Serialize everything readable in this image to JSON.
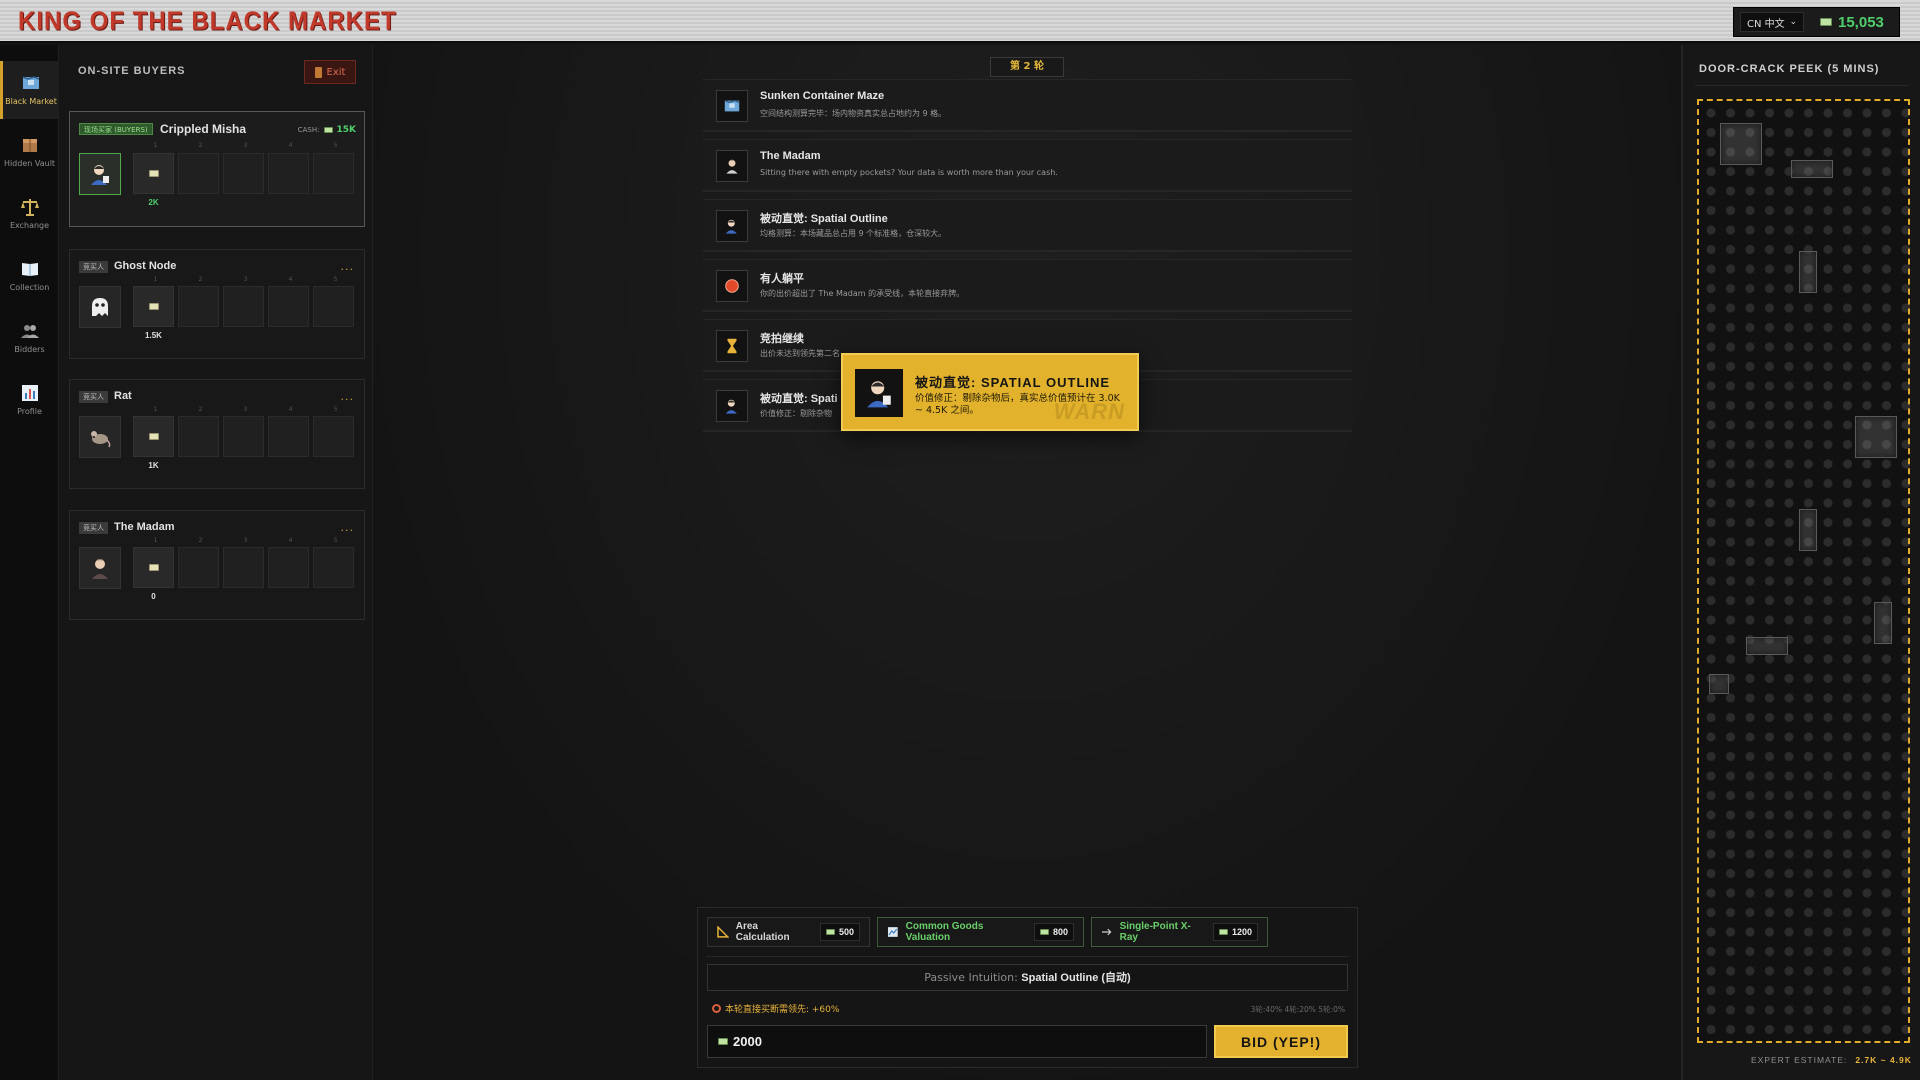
{
  "app": {
    "title": "KING OF THE BLACK MARKET",
    "language": "CN 中文",
    "cash": "15,053"
  },
  "nav": [
    {
      "label": "Black Market",
      "icon": "map-icon",
      "active": true
    },
    {
      "label": "Hidden Vault",
      "icon": "crate-icon"
    },
    {
      "label": "Exchange",
      "icon": "scale-icon"
    },
    {
      "label": "Collection",
      "icon": "book-icon"
    },
    {
      "label": "Bidders",
      "icon": "users-icon"
    },
    {
      "label": "Profile",
      "icon": "bar-chart-icon"
    }
  ],
  "buyers": {
    "title": "ON-SITE BUYERS",
    "exit_label": "Exit",
    "cards": [
      {
        "tag": "现场买家 (BUYERS)",
        "name": "Crippled Misha",
        "cash_label": "CASH:",
        "cash": "15K",
        "slots": [
          "1",
          "2",
          "3",
          "4",
          "5"
        ],
        "bid": "2K",
        "is_me": true,
        "avatar": "crippled-misha-avatar"
      },
      {
        "tag": "竞买人",
        "name": "Ghost Node",
        "more": "...",
        "slots": [
          "1",
          "2",
          "3",
          "4",
          "5"
        ],
        "bid": "1.5K",
        "avatar": "ghost-avatar"
      },
      {
        "tag": "竞买人",
        "name": "Rat",
        "more": "...",
        "slots": [
          "1",
          "2",
          "3",
          "4",
          "5"
        ],
        "bid": "1K",
        "avatar": "rat-avatar"
      },
      {
        "tag": "竞买人",
        "name": "The Madam",
        "more": "...",
        "slots": [
          "1",
          "2",
          "3",
          "4",
          "5"
        ],
        "bid": "0",
        "avatar": "madam-avatar"
      }
    ]
  },
  "center": {
    "round": "第 2 轮",
    "events": [
      {
        "title": "Sunken Container Maze",
        "desc": "空间结构测算完毕：场内物资真实总占地约为 9 格。",
        "icon": "map-icon"
      },
      {
        "title": "The Madam",
        "desc": "Sitting there with empty pockets? Your data is worth more than your cash.",
        "icon": "madam-avatar"
      },
      {
        "title": "被动直觉: Spatial Outline",
        "desc": "均格测算：本场藏品总占用 9 个标准格，仓深较大。",
        "icon": "crippled-misha-avatar"
      },
      {
        "title": "有人躺平",
        "desc": "你的出价超出了 The Madam 的承受线，本轮直接弃牌。",
        "icon": "red-circle-icon"
      },
      {
        "title": "竞拍继续",
        "desc": "出价未达到领先第二名",
        "icon": "hourglass-icon"
      },
      {
        "title": "被动直觉: Spati",
        "desc": "价值修正：剔除杂物",
        "icon": "crippled-misha-avatar"
      }
    ],
    "popup": {
      "title": "被动直觉: SPATIAL OUTLINE",
      "desc": "价值修正：剔除杂物后，真实总价值预计在 3.0K ~ 4.5K 之间。",
      "watermark": "WARN"
    },
    "tools": [
      {
        "label": "Area Calculation",
        "cost": "500",
        "icon": "ruler-icon"
      },
      {
        "label": "Common Goods Valuation",
        "cost": "800",
        "icon": "chart-icon"
      },
      {
        "label": "Single-Point X-Ray",
        "cost": "1200",
        "icon": "arrow-right-icon"
      }
    ],
    "passive_prefix": "Passive Intuition:",
    "passive_value": "Spatial Outline (自动)",
    "hint": "本轮直接买断需领先: +60%",
    "odds": "3轮:40% 4轮:20% 5轮:0%",
    "bid_value": "2000",
    "bid_button": "BID (YEP!)"
  },
  "peek": {
    "title": "DOOR-CRACK PEEK (5 MINS)",
    "estimate_label": "EXPERT ESTIMATE:",
    "estimate_value": "2.7K ~ 4.9K"
  },
  "colors": {
    "accent": "#e2b22c",
    "cash_green": "#4fcf6b",
    "title_red": "#c0392b"
  }
}
